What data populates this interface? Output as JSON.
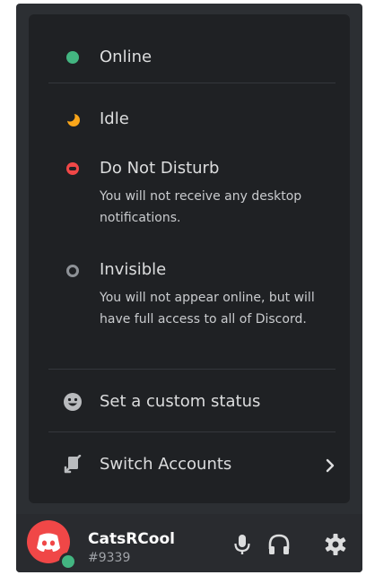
{
  "status_menu": {
    "online": {
      "label": "Online"
    },
    "idle": {
      "label": "Idle"
    },
    "dnd": {
      "label": "Do Not Disturb",
      "description": "You will not receive any desktop notifications."
    },
    "invisible": {
      "label": "Invisible",
      "description": "You will not appear online, but will have full access to all of Discord."
    },
    "custom_status": {
      "label": "Set a custom status",
      "icon": "smiley-icon"
    },
    "switch_accounts": {
      "label": "Switch Accounts",
      "icon": "switch-accounts-icon"
    }
  },
  "user_panel": {
    "username": "CatsRCool",
    "discriminator": "#9339",
    "status": "online",
    "buttons": [
      "microphone-icon",
      "headphones-icon",
      "settings-gear-icon"
    ]
  },
  "colors": {
    "online": "#43b581",
    "idle": "#faa61a",
    "dnd": "#f04747",
    "invisible": "#8e9297",
    "menu_bg": "#1f2124",
    "panel_bg": "#292b2f",
    "text": "#dcddde"
  }
}
